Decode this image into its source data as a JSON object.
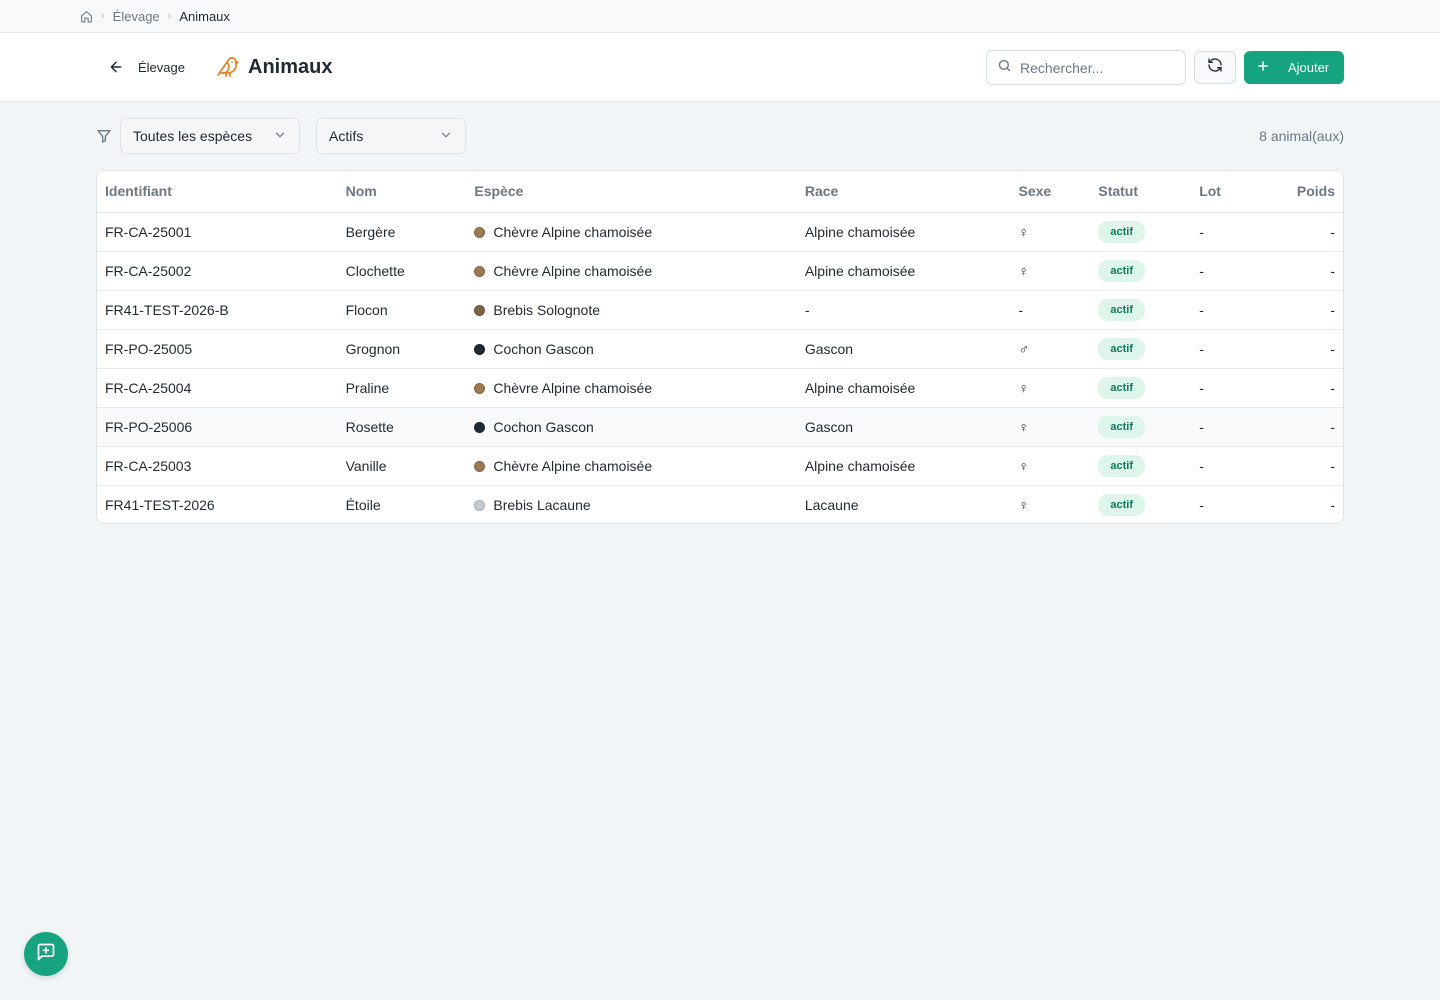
{
  "breadcrumb": {
    "items": [
      "Élevage",
      "Animaux"
    ]
  },
  "header": {
    "back_label": "Élevage",
    "title": "Animaux",
    "search_placeholder": "Rechercher...",
    "add_label": "Ajouter"
  },
  "filters": {
    "species_value": "Toutes les espèces",
    "status_value": "Actifs",
    "count_label": "8 animal(aux)"
  },
  "table": {
    "columns": [
      "Identifiant",
      "Nom",
      "Espèce",
      "Race",
      "Sexe",
      "Statut",
      "Lot",
      "Poids"
    ],
    "rows": [
      {
        "id": "FR-CA-25001",
        "name": "Bergère",
        "species": "Chèvre Alpine chamoisée",
        "species_color": "#9b7a52",
        "breed": "Alpine chamoisée",
        "sex": "♀",
        "status": "actif",
        "lot": "-",
        "weight": "-"
      },
      {
        "id": "FR-CA-25002",
        "name": "Clochette",
        "species": "Chèvre Alpine chamoisée",
        "species_color": "#9b7a52",
        "breed": "Alpine chamoisée",
        "sex": "♀",
        "status": "actif",
        "lot": "-",
        "weight": "-"
      },
      {
        "id": "FR41-TEST-2026-B",
        "name": "Flocon",
        "species": "Brebis Solognote",
        "species_color": "#7d6346",
        "breed": "-",
        "sex": "-",
        "status": "actif",
        "lot": "-",
        "weight": "-"
      },
      {
        "id": "FR-PO-25005",
        "name": "Grognon",
        "species": "Cochon Gascon",
        "species_color": "#1f2933",
        "breed": "Gascon",
        "sex": "♂",
        "status": "actif",
        "lot": "-",
        "weight": "-"
      },
      {
        "id": "FR-CA-25004",
        "name": "Praline",
        "species": "Chèvre Alpine chamoisée",
        "species_color": "#9b7a52",
        "breed": "Alpine chamoisée",
        "sex": "♀",
        "status": "actif",
        "lot": "-",
        "weight": "-"
      },
      {
        "id": "FR-PO-25006",
        "name": "Rosette",
        "species": "Cochon Gascon",
        "species_color": "#1f2933",
        "breed": "Gascon",
        "sex": "♀",
        "status": "actif",
        "lot": "-",
        "weight": "-"
      },
      {
        "id": "FR-CA-25003",
        "name": "Vanille",
        "species": "Chèvre Alpine chamoisée",
        "species_color": "#9b7a52",
        "breed": "Alpine chamoisée",
        "sex": "♀",
        "status": "actif",
        "lot": "-",
        "weight": "-"
      },
      {
        "id": "FR41-TEST-2026",
        "name": "Étoile",
        "species": "Brebis Lacaune",
        "species_color": "#c5cad0",
        "breed": "Lacaune",
        "sex": "♀",
        "status": "actif",
        "lot": "-",
        "weight": "-"
      }
    ]
  },
  "colors": {
    "accent": "#16a37f",
    "badge_bg": "#ddf5ea",
    "badge_text": "#127a5e"
  },
  "icons": [
    "home-icon",
    "chevron-right-icon",
    "arrow-left-icon",
    "bird-icon",
    "search-icon",
    "refresh-icon",
    "plus-icon",
    "filter-icon",
    "chevron-down-icon",
    "chat-icon"
  ]
}
